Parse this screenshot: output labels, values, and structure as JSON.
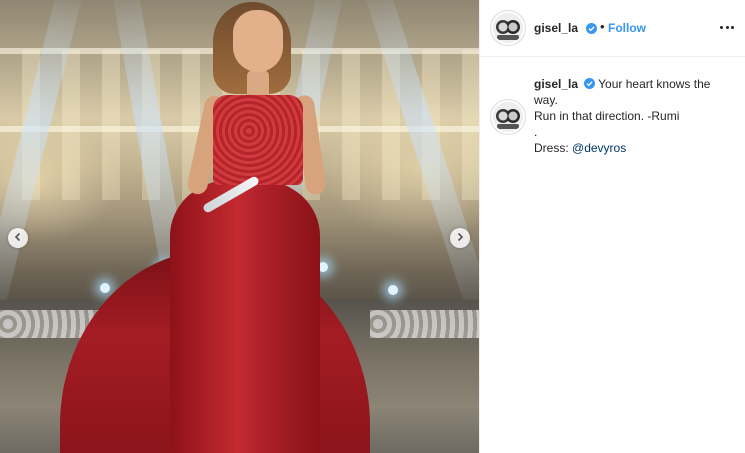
{
  "post": {
    "author": {
      "username": "gisel_la",
      "verified": true,
      "avatar_icon": "profile-avatar-icon"
    },
    "header": {
      "separator": "•",
      "follow_label": "Follow",
      "more_icon": "more-options-icon"
    },
    "caption": {
      "username": "gisel_la",
      "line1": "Your heart knows the way.",
      "line2": "Run in that direction. -Rumi",
      "line3": ".",
      "dress_label": "Dress:",
      "dress_mention": "@devyros"
    },
    "media": {
      "prev_icon": "chevron-left-icon",
      "next_icon": "chevron-right-icon"
    }
  },
  "colors": {
    "link_blue": "#3897f0",
    "mention": "#003569",
    "verified": "#3897f0",
    "text": "#262626",
    "divider": "#efefef",
    "gown_red": "#b0222a"
  }
}
